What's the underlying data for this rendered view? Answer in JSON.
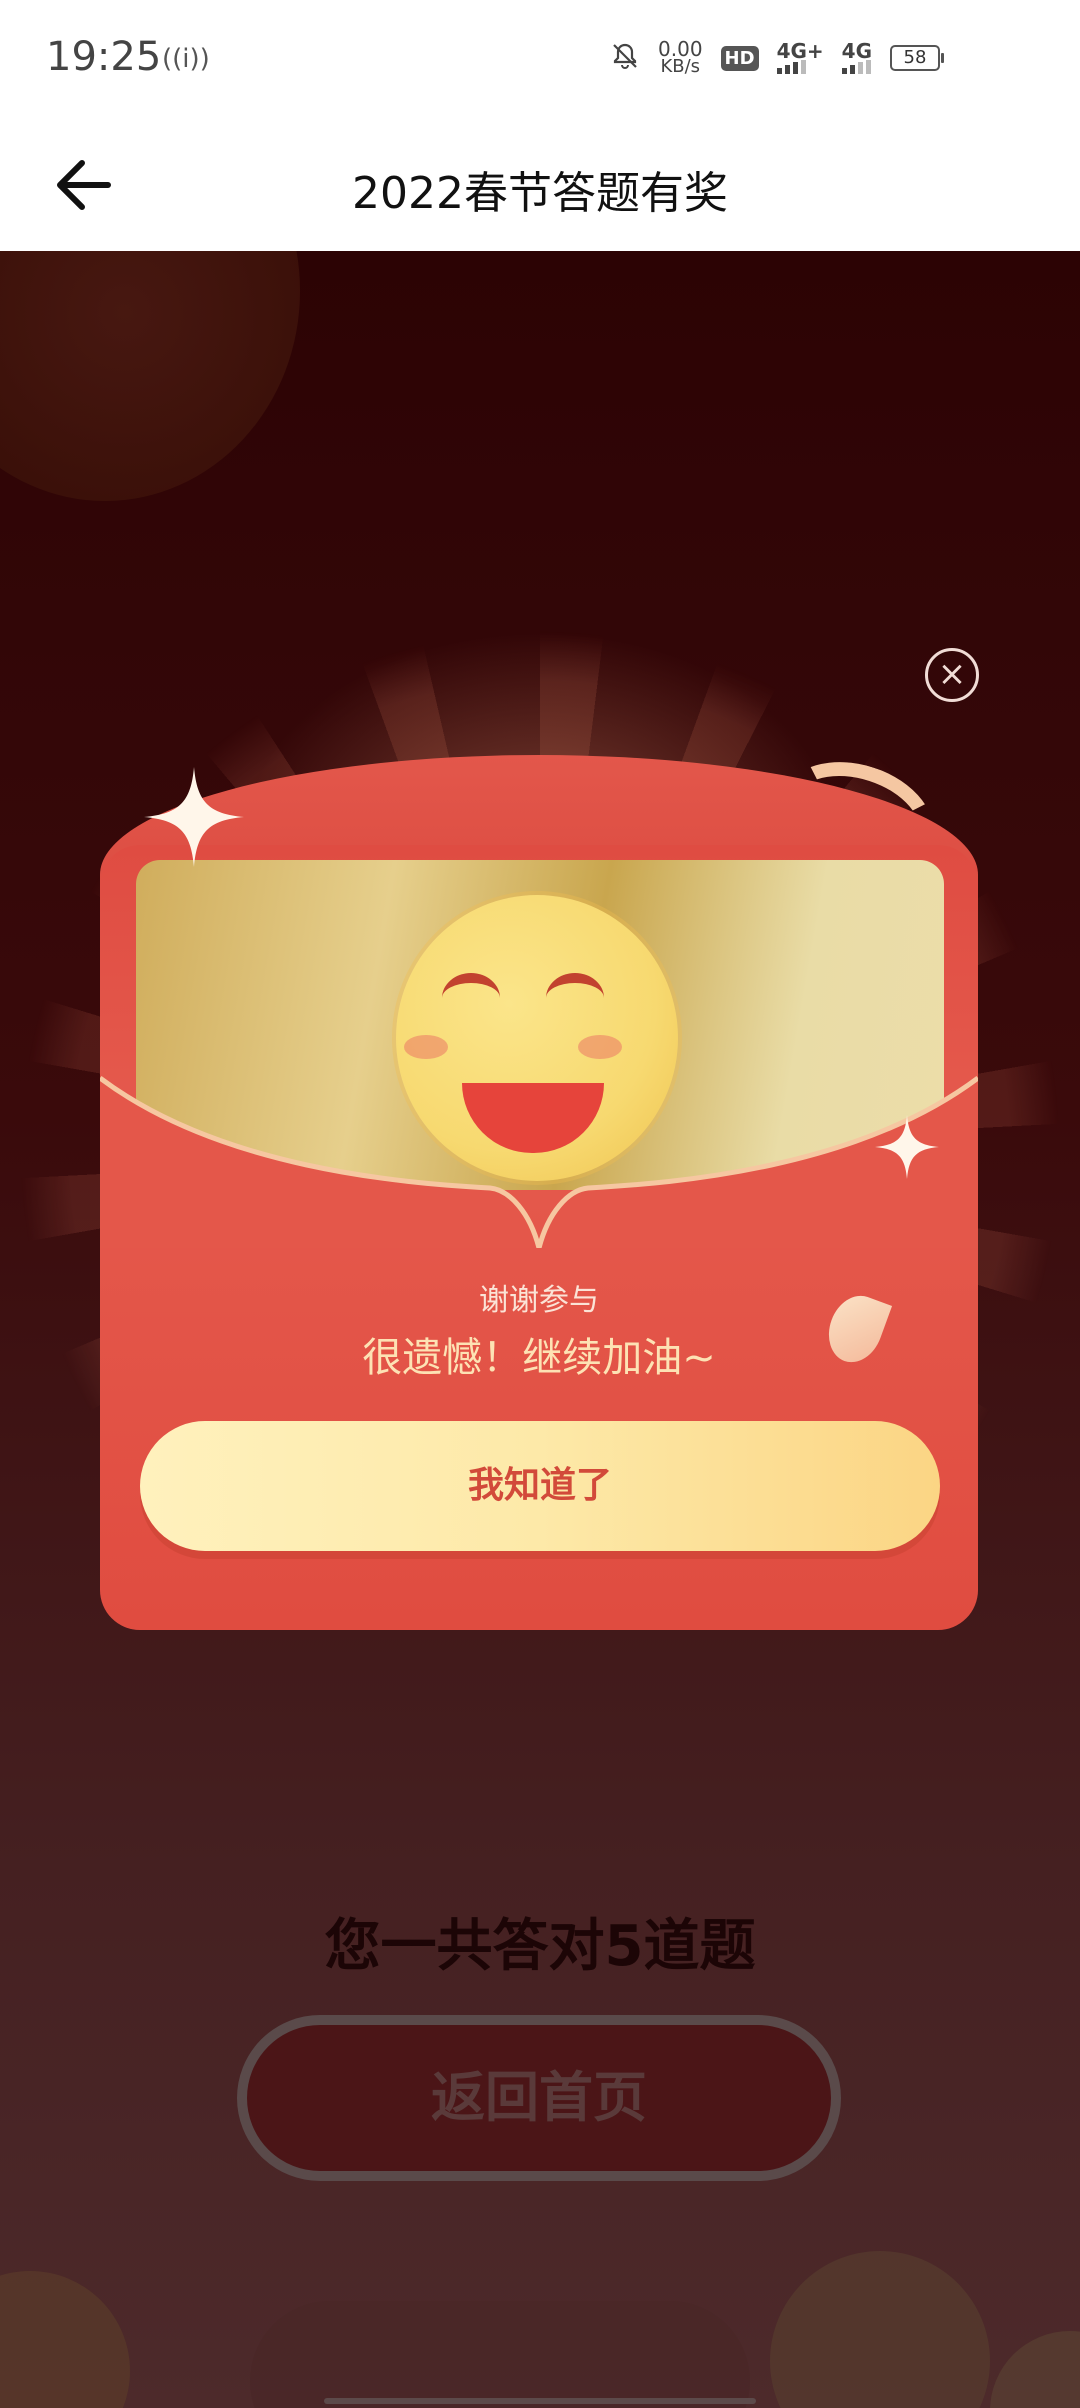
{
  "status_bar": {
    "time": "19:25",
    "hotspot_icon": "((i))",
    "net_speed_value": "0.00",
    "net_speed_unit": "KB/s",
    "hd_label": "HD",
    "sim1_label": "4G+",
    "sim2_label": "4G",
    "battery": "58"
  },
  "header": {
    "title": "2022春节答题有奖",
    "back_icon": "arrow-left"
  },
  "popup": {
    "close_icon": "×",
    "thanks_text": "谢谢参与",
    "message": "很遗憾！继续加油~",
    "ok_button": "我知道了"
  },
  "page": {
    "score_text": "您一共答对5道题",
    "home_button": "返回首页"
  },
  "colors": {
    "envelope_red": "#e04c40",
    "button_gold": "#fde9a8",
    "button_text": "#d24a3a",
    "background_dark": "#2c0304"
  }
}
